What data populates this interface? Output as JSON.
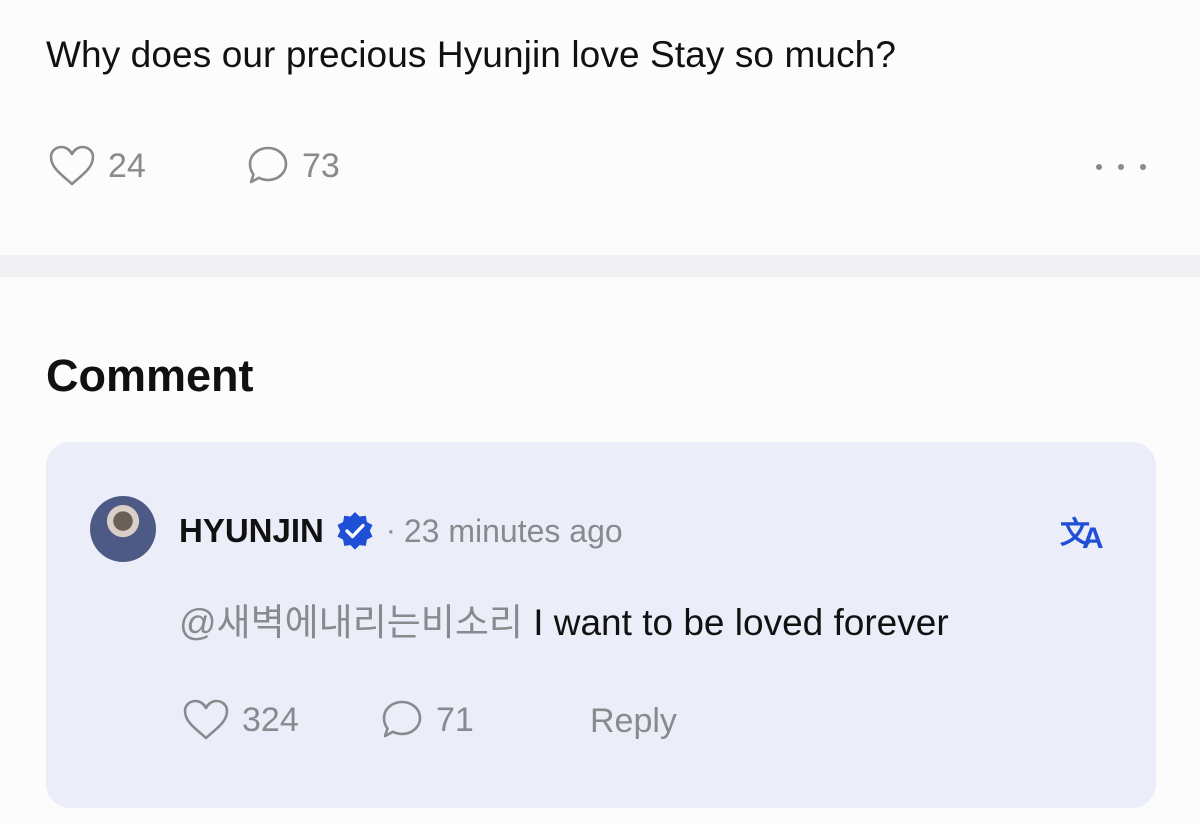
{
  "post": {
    "text": "Why does our precious Hyunjin love Stay so much?",
    "likes": "24",
    "comments": "73",
    "icons": {
      "like": "heart-icon",
      "comment": "speech-bubble-icon",
      "more": "more-dots-icon"
    }
  },
  "comments_section": {
    "title": "Comment",
    "items": [
      {
        "author": "HYUNJIN",
        "verified": true,
        "separator": "·",
        "time": "23 minutes ago",
        "mention": "@새벽에내리는비소리",
        "text": "I want to be loved forever",
        "likes": "324",
        "replies": "71",
        "reply_label": "Reply",
        "icons": {
          "verified": "verified-badge-icon",
          "translate": "translate-icon"
        }
      }
    ]
  },
  "colors": {
    "text": "#111111",
    "muted": "#8a8a8e",
    "accent": "#1f4fd6",
    "card_bg": "#ebeef8",
    "page_bg": "#fcfcfd"
  }
}
